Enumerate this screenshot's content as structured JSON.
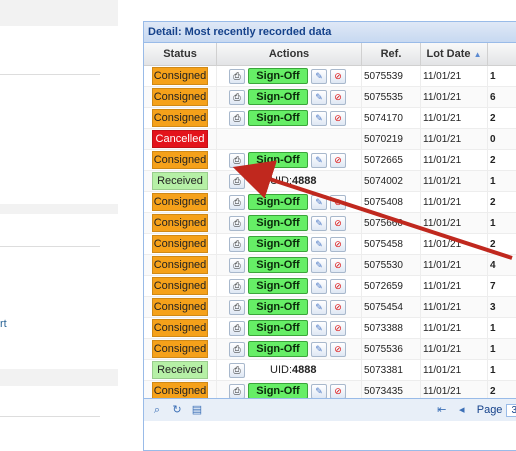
{
  "left_panel": {
    "fragment_text": "rt"
  },
  "grid": {
    "title": "Detail: Most recently recorded data",
    "headers": {
      "status": "Status",
      "actions": "Actions",
      "ref": "Ref.",
      "lot_date": "Lot Date",
      "extra": ""
    },
    "signoff_label": "Sign-Off",
    "uid_prefix": "UID:",
    "rows": [
      {
        "status": "Consigned",
        "actions": "full",
        "ref": "5075539",
        "date": "11/01/21",
        "extra": "1"
      },
      {
        "status": "Consigned",
        "actions": "full",
        "ref": "5075535",
        "date": "11/01/21",
        "extra": "6"
      },
      {
        "status": "Consigned",
        "actions": "full",
        "ref": "5074170",
        "date": "11/01/21",
        "extra": "2"
      },
      {
        "status": "Cancelled",
        "actions": "none",
        "ref": "5070219",
        "date": "11/01/21",
        "extra": "0"
      },
      {
        "status": "Consigned",
        "actions": "full",
        "ref": "5072665",
        "date": "11/01/21",
        "extra": "2"
      },
      {
        "status": "Received",
        "actions": "uid",
        "uid": "4888",
        "ref": "5074002",
        "date": "11/01/21",
        "extra": "1"
      },
      {
        "status": "Consigned",
        "actions": "full",
        "ref": "5075408",
        "date": "11/01/21",
        "extra": "2"
      },
      {
        "status": "Consigned",
        "actions": "full",
        "ref": "5075660",
        "date": "11/01/21",
        "extra": "1"
      },
      {
        "status": "Consigned",
        "actions": "full",
        "ref": "5075458",
        "date": "11/01/21",
        "extra": "2"
      },
      {
        "status": "Consigned",
        "actions": "full",
        "ref": "5075530",
        "date": "11/01/21",
        "extra": "4"
      },
      {
        "status": "Consigned",
        "actions": "full",
        "ref": "5072659",
        "date": "11/01/21",
        "extra": "7"
      },
      {
        "status": "Consigned",
        "actions": "full",
        "ref": "5075454",
        "date": "11/01/21",
        "extra": "3"
      },
      {
        "status": "Consigned",
        "actions": "full",
        "ref": "5073388",
        "date": "11/01/21",
        "extra": "1"
      },
      {
        "status": "Consigned",
        "actions": "full",
        "ref": "5075536",
        "date": "11/01/21",
        "extra": "1"
      },
      {
        "status": "Received",
        "actions": "uid",
        "uid": "4888",
        "ref": "5073381",
        "date": "11/01/21",
        "extra": "1"
      },
      {
        "status": "Consigned",
        "actions": "full",
        "ref": "5073435",
        "date": "11/01/21",
        "extra": "2"
      }
    ],
    "paging": {
      "page_label": "Page",
      "page_value": "3"
    }
  },
  "icons": {
    "print": "print-icon",
    "edit": "pencil-icon",
    "delete": "no-entry-icon",
    "search": "magnifier-icon",
    "refresh": "refresh-icon",
    "export": "document-icon",
    "first": "first-page-icon",
    "prev": "previous-page-icon"
  },
  "colors": {
    "consigned": "#f5a11a",
    "cancelled": "#e3131b",
    "received": "#b6f0a6",
    "signoff": "#66ee66",
    "arrow": "#c0281e"
  }
}
